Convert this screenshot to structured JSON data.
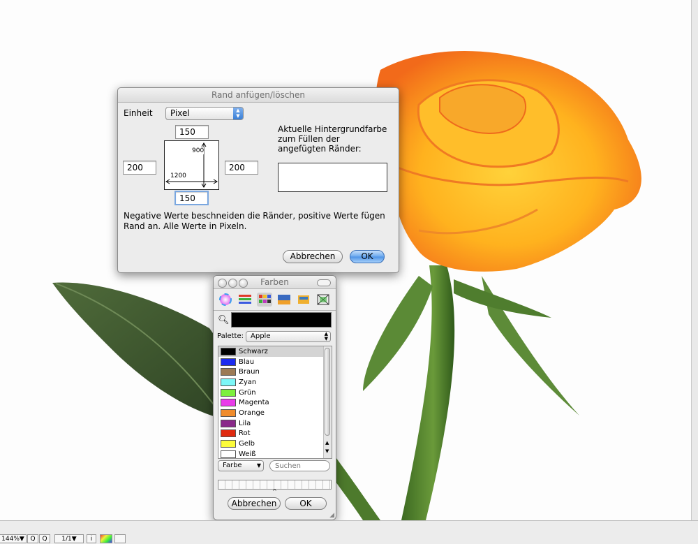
{
  "border_dialog": {
    "title": "Rand anfügen/löschen",
    "unit_label": "Einheit",
    "unit_value": "Pixel",
    "top_value": "150",
    "left_value": "200",
    "right_value": "200",
    "bottom_value": "150",
    "image_height": "900",
    "image_width": "1200",
    "bgcolor_label": "Aktuelle Hintergrundfarbe zum Füllen der angefügten Ränder:",
    "bgcolor_value": "#ffffff",
    "note": "Negative Werte beschneiden die Ränder, positive Werte fügen Rand an. Alle Werte in Pixeln.",
    "cancel_label": "Abbrechen",
    "ok_label": "OK"
  },
  "color_panel": {
    "title": "Farben",
    "tabs": [
      "color-wheel-icon",
      "color-sliders-icon",
      "color-palettes-icon",
      "image-palettes-icon",
      "crayons-icon",
      "spectrum-picker-icon"
    ],
    "current_color": "#000000",
    "palette_label": "Palette:",
    "palette_value": "Apple",
    "colors": [
      {
        "name": "Schwarz",
        "hex": "#000000"
      },
      {
        "name": "Blau",
        "hex": "#1b2bf0"
      },
      {
        "name": "Braun",
        "hex": "#9c7a55"
      },
      {
        "name": "Zyan",
        "hex": "#7cf7f7"
      },
      {
        "name": "Grün",
        "hex": "#7cf03c"
      },
      {
        "name": "Magenta",
        "hex": "#ea3cea"
      },
      {
        "name": "Orange",
        "hex": "#f08c2c"
      },
      {
        "name": "Lila",
        "hex": "#8a2a8a"
      },
      {
        "name": "Rot",
        "hex": "#e02a10"
      },
      {
        "name": "Gelb",
        "hex": "#fbfb3a"
      },
      {
        "name": "Weiß",
        "hex": "#ffffff"
      }
    ],
    "selected_index": 0,
    "list_menu": "Farbe",
    "search_placeholder": "Suchen",
    "cancel_label": "Abbrechen",
    "ok_label": "OK"
  },
  "statusbar": {
    "zoom": "144%▼",
    "page": "1/1▼"
  }
}
